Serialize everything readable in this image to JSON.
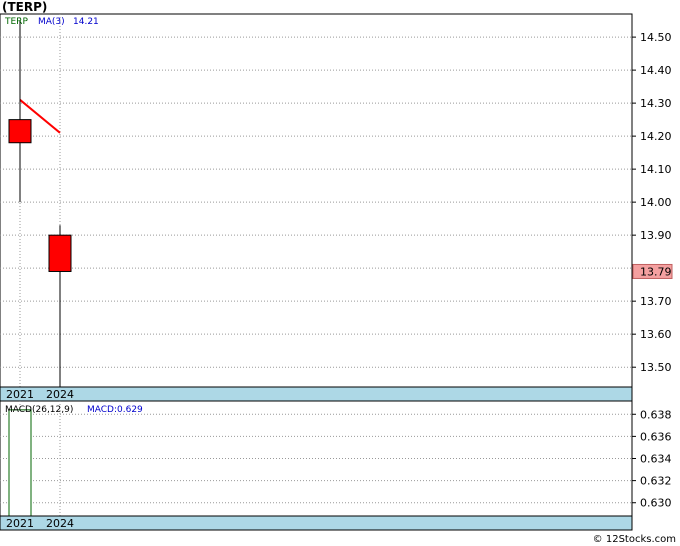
{
  "title": "(TERP)",
  "footer": "© 12Stocks.com",
  "colors": {
    "candle_down": "#ff0000",
    "ma_line": "#ff0000",
    "macd_bar": "#ffffff",
    "macd_bar_border": "#006600",
    "axis_band": "#add8e6",
    "last_price_box": "#f4a0a0",
    "legend_ticker": "#006600",
    "legend_ma": "#0000cc"
  },
  "chart_data": [
    {
      "type": "candlestick",
      "legend": {
        "ticker": "TERP",
        "ma_label": "MA(3)",
        "ma_value": "14.21"
      },
      "categories": [
        "2021",
        "2024"
      ],
      "candles": [
        {
          "x": "2021",
          "open": 14.25,
          "high": 14.55,
          "low": 14.0,
          "close": 14.18
        },
        {
          "x": "2024",
          "open": 13.9,
          "high": 13.93,
          "low": 13.44,
          "close": 13.79
        }
      ],
      "ma_series": {
        "name": "MA(3)",
        "points": [
          {
            "x": "2021",
            "y": 14.31
          },
          {
            "x": "2024",
            "y": 14.21
          }
        ]
      },
      "last_price": "13.79",
      "last_price_value": 13.79,
      "ylim": [
        13.44,
        14.57
      ],
      "yticks": [
        "13.50",
        "13.60",
        "13.70",
        "13.80",
        "13.90",
        "14.00",
        "14.10",
        "14.20",
        "14.30",
        "14.40",
        "14.50"
      ],
      "xlabels": [
        "2021",
        "2024"
      ],
      "grid": true
    },
    {
      "type": "bar",
      "legend": {
        "label": "MACD(26,12,9)",
        "value_label": "MACD:0.629"
      },
      "categories": [
        "2021",
        "2024"
      ],
      "values": [
        0.6384,
        null
      ],
      "ylim": [
        0.6288,
        0.6392
      ],
      "yticks": [
        "0.630",
        "0.632",
        "0.634",
        "0.636",
        "0.638"
      ],
      "xlabels": [
        "2021",
        "2024"
      ],
      "grid": true
    }
  ]
}
